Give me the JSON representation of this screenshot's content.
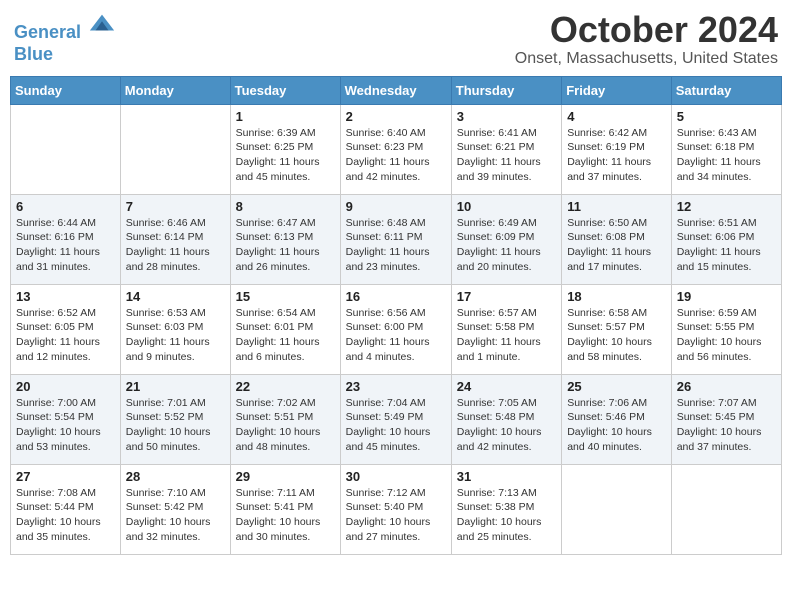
{
  "header": {
    "logo_line1": "General",
    "logo_line2": "Blue",
    "title": "October 2024",
    "subtitle": "Onset, Massachusetts, United States"
  },
  "weekdays": [
    "Sunday",
    "Monday",
    "Tuesday",
    "Wednesday",
    "Thursday",
    "Friday",
    "Saturday"
  ],
  "weeks": [
    [
      {
        "day": "",
        "info": ""
      },
      {
        "day": "",
        "info": ""
      },
      {
        "day": "1",
        "info": "Sunrise: 6:39 AM\nSunset: 6:25 PM\nDaylight: 11 hours and 45 minutes."
      },
      {
        "day": "2",
        "info": "Sunrise: 6:40 AM\nSunset: 6:23 PM\nDaylight: 11 hours and 42 minutes."
      },
      {
        "day": "3",
        "info": "Sunrise: 6:41 AM\nSunset: 6:21 PM\nDaylight: 11 hours and 39 minutes."
      },
      {
        "day": "4",
        "info": "Sunrise: 6:42 AM\nSunset: 6:19 PM\nDaylight: 11 hours and 37 minutes."
      },
      {
        "day": "5",
        "info": "Sunrise: 6:43 AM\nSunset: 6:18 PM\nDaylight: 11 hours and 34 minutes."
      }
    ],
    [
      {
        "day": "6",
        "info": "Sunrise: 6:44 AM\nSunset: 6:16 PM\nDaylight: 11 hours and 31 minutes."
      },
      {
        "day": "7",
        "info": "Sunrise: 6:46 AM\nSunset: 6:14 PM\nDaylight: 11 hours and 28 minutes."
      },
      {
        "day": "8",
        "info": "Sunrise: 6:47 AM\nSunset: 6:13 PM\nDaylight: 11 hours and 26 minutes."
      },
      {
        "day": "9",
        "info": "Sunrise: 6:48 AM\nSunset: 6:11 PM\nDaylight: 11 hours and 23 minutes."
      },
      {
        "day": "10",
        "info": "Sunrise: 6:49 AM\nSunset: 6:09 PM\nDaylight: 11 hours and 20 minutes."
      },
      {
        "day": "11",
        "info": "Sunrise: 6:50 AM\nSunset: 6:08 PM\nDaylight: 11 hours and 17 minutes."
      },
      {
        "day": "12",
        "info": "Sunrise: 6:51 AM\nSunset: 6:06 PM\nDaylight: 11 hours and 15 minutes."
      }
    ],
    [
      {
        "day": "13",
        "info": "Sunrise: 6:52 AM\nSunset: 6:05 PM\nDaylight: 11 hours and 12 minutes."
      },
      {
        "day": "14",
        "info": "Sunrise: 6:53 AM\nSunset: 6:03 PM\nDaylight: 11 hours and 9 minutes."
      },
      {
        "day": "15",
        "info": "Sunrise: 6:54 AM\nSunset: 6:01 PM\nDaylight: 11 hours and 6 minutes."
      },
      {
        "day": "16",
        "info": "Sunrise: 6:56 AM\nSunset: 6:00 PM\nDaylight: 11 hours and 4 minutes."
      },
      {
        "day": "17",
        "info": "Sunrise: 6:57 AM\nSunset: 5:58 PM\nDaylight: 11 hours and 1 minute."
      },
      {
        "day": "18",
        "info": "Sunrise: 6:58 AM\nSunset: 5:57 PM\nDaylight: 10 hours and 58 minutes."
      },
      {
        "day": "19",
        "info": "Sunrise: 6:59 AM\nSunset: 5:55 PM\nDaylight: 10 hours and 56 minutes."
      }
    ],
    [
      {
        "day": "20",
        "info": "Sunrise: 7:00 AM\nSunset: 5:54 PM\nDaylight: 10 hours and 53 minutes."
      },
      {
        "day": "21",
        "info": "Sunrise: 7:01 AM\nSunset: 5:52 PM\nDaylight: 10 hours and 50 minutes."
      },
      {
        "day": "22",
        "info": "Sunrise: 7:02 AM\nSunset: 5:51 PM\nDaylight: 10 hours and 48 minutes."
      },
      {
        "day": "23",
        "info": "Sunrise: 7:04 AM\nSunset: 5:49 PM\nDaylight: 10 hours and 45 minutes."
      },
      {
        "day": "24",
        "info": "Sunrise: 7:05 AM\nSunset: 5:48 PM\nDaylight: 10 hours and 42 minutes."
      },
      {
        "day": "25",
        "info": "Sunrise: 7:06 AM\nSunset: 5:46 PM\nDaylight: 10 hours and 40 minutes."
      },
      {
        "day": "26",
        "info": "Sunrise: 7:07 AM\nSunset: 5:45 PM\nDaylight: 10 hours and 37 minutes."
      }
    ],
    [
      {
        "day": "27",
        "info": "Sunrise: 7:08 AM\nSunset: 5:44 PM\nDaylight: 10 hours and 35 minutes."
      },
      {
        "day": "28",
        "info": "Sunrise: 7:10 AM\nSunset: 5:42 PM\nDaylight: 10 hours and 32 minutes."
      },
      {
        "day": "29",
        "info": "Sunrise: 7:11 AM\nSunset: 5:41 PM\nDaylight: 10 hours and 30 minutes."
      },
      {
        "day": "30",
        "info": "Sunrise: 7:12 AM\nSunset: 5:40 PM\nDaylight: 10 hours and 27 minutes."
      },
      {
        "day": "31",
        "info": "Sunrise: 7:13 AM\nSunset: 5:38 PM\nDaylight: 10 hours and 25 minutes."
      },
      {
        "day": "",
        "info": ""
      },
      {
        "day": "",
        "info": ""
      }
    ]
  ]
}
